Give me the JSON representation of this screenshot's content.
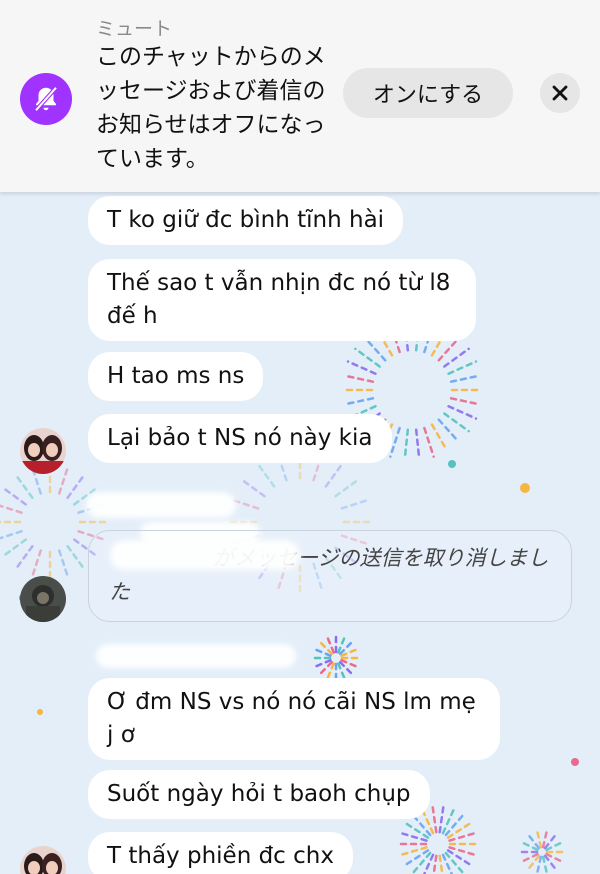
{
  "banner": {
    "label": "ミュート",
    "text": "このチャットからのメッセージおよび着信のお知らせはオフになっています。",
    "turn_on_label": "オンにする",
    "icon": "bell-off-icon",
    "close_icon": "close-icon",
    "accent": "#a033ff"
  },
  "messages": [
    {
      "text": "T ko giữ đc bình tĩnh hài"
    },
    {
      "text": "Thế sao t vẫn nhịn đc nó từ l8 đế h"
    },
    {
      "text": "H tao ms ns"
    },
    {
      "text": "Lại bảo t NS nó này kia"
    },
    {
      "text": "Ơ đm NS vs nó nó cãi NS lm mẹ j ơ"
    },
    {
      "text": "Suốt ngày hỏi t baoh chụp"
    },
    {
      "text": "T thấy phiền đc chx"
    }
  ],
  "unsent_notice": {
    "visible_text": "がメッセージの送信を取り消しました"
  },
  "colors": {
    "chat_background": "#e3eef9",
    "bubble": "#ffffff"
  }
}
